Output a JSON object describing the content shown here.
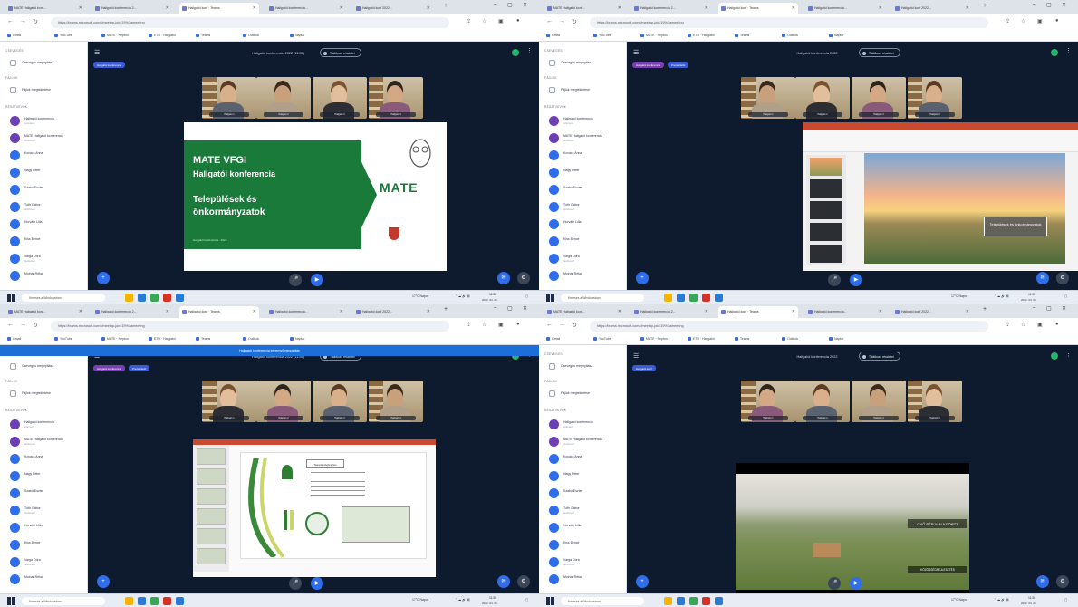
{
  "screens": [
    {
      "tabs": [
        "MATE Hallgatói konf...",
        "Hallgatói konferencia 2...",
        "Hallgatói konf · Teams",
        "Hallgatói konferencia...",
        "Hallgatói konf 2022..."
      ],
      "url": "https://teams.microsoft.com/l/meetup-join/19%3ameeting",
      "bookmarks": [
        "Gmail",
        "YouTube",
        "MATE · Neptun",
        "ETR · Hallgatói",
        "Teams",
        "Outlook",
        "Naptár"
      ],
      "banner": "",
      "meeting_title": "Hallgatói konferencia 2022 (11:55)",
      "action_button": "Találkozó részletei",
      "chips": [
        "Hallgatói konferencia"
      ],
      "thumbs": [
        "Hallgató 1",
        "Hallgató 2",
        "Hallgató 3",
        "Hallgató 4"
      ],
      "slide": {
        "title": "MATE VFGI",
        "subtitle": "Hallgatói konferencia",
        "topic1": "Települések és",
        "topic2": "önkormányzatok",
        "footer": "Hallgatói konferencia · 2022",
        "logo": "MATE"
      }
    },
    {
      "tabs": [
        "MATE Hallgatói konf...",
        "Hallgatói konferencia 2...",
        "Hallgatói konf · Teams",
        "Hallgatói konferencia...",
        "Hallgatói konf 2022..."
      ],
      "url": "https://teams.microsoft.com/l/meetup-join/19%3ameeting",
      "bookmarks": [
        "Gmail",
        "YouTube",
        "MATE · Neptun",
        "ETR · Hallgatói",
        "Teams",
        "Outlook",
        "Naptár"
      ],
      "banner": "",
      "meeting_title": "Hallgatói konferencia 2022",
      "action_button": "Találkozó részletei",
      "chips": [
        "Hallgatói konferencia",
        "Prezentáció"
      ],
      "thumbs": [
        "Hallgató 1",
        "Hallgató 2",
        "Hallgató 3",
        "Hallgató 4"
      ],
      "slide": {
        "caption": "Települések és önkormányzatok"
      }
    },
    {
      "tabs": [
        "MATE Hallgatói konf...",
        "Hallgatói konferencia 2...",
        "Hallgatói konf · Teams",
        "Hallgatói konferencia...",
        "Hallgatói konf 2022..."
      ],
      "url": "https://teams.microsoft.com/l/meetup-join/19%3ameeting",
      "bookmarks": [
        "Gmail",
        "YouTube",
        "MATE · Neptun",
        "ETR · Hallgatói",
        "Teams",
        "Outlook",
        "Naptár"
      ],
      "banner": "Hallgatói konferencia képernyőmegosztás",
      "meeting_title": "Hallgatói konferencia 2022 (11:55)",
      "action_button": "Találkozó részletei",
      "chips": [
        "Hallgatói konferencia",
        "Prezentáció"
      ],
      "thumbs": [
        "Hallgató 1",
        "Hallgató 2",
        "Hallgató 3",
        "Hallgató 4"
      ],
      "slide": {
        "box": "Településfejlesztés"
      }
    },
    {
      "tabs": [
        "MATE Hallgatói konf...",
        "Hallgatói konferencia 2...",
        "Hallgatói konf · Teams",
        "Hallgatói konferencia...",
        "Hallgatói konf 2022..."
      ],
      "url": "https://teams.microsoft.com/l/meetup-join/19%3ameeting",
      "bookmarks": [
        "Gmail",
        "YouTube",
        "MATE · Neptun",
        "ETR · Hallgatói",
        "Teams",
        "Outlook",
        "Naptár"
      ],
      "banner": "",
      "meeting_title": "Hallgatói konferencia 2022",
      "action_button": "Találkozó részletei",
      "chips": [
        "Hallgatói konf"
      ],
      "thumbs": [
        "Hallgató 1",
        "Hallgató 2",
        "Hallgató 3",
        "Hallgató 4"
      ],
      "slide": {
        "overlay1": "GYŐ PÉR VAN AZ ÖRTT",
        "overlay2": "KÖZÖSSÉGFEJLESZTÉS"
      }
    }
  ],
  "sidebar": {
    "section1": "Csevegés",
    "item1": "Csevegés megnyitása",
    "section2": "Fájlok",
    "item2": "Fájlok megtekintése",
    "section3": "Résztvevők",
    "users": [
      {
        "name": "Hallgatói konferencia",
        "sub": "szervező"
      },
      {
        "name": "MATE Hallgatói konferencia",
        "sub": "résztvevő"
      },
      {
        "name": "Kovács Anna",
        "sub": ""
      },
      {
        "name": "Nagy Péter",
        "sub": ""
      },
      {
        "name": "Szabó Eszter",
        "sub": ""
      },
      {
        "name": "Tóth Gábor",
        "sub": "résztvevő"
      },
      {
        "name": "Horváth Lilla",
        "sub": ""
      },
      {
        "name": "Kiss Bence",
        "sub": ""
      },
      {
        "name": "Varga Dóra",
        "sub": "résztvevő"
      },
      {
        "name": "Molnár Réka",
        "sub": ""
      }
    ]
  },
  "taskbar": {
    "search": "Keresés a Windowsban",
    "weather": "17°C Napos",
    "time": "11:55",
    "date": "2022. 04. 26."
  },
  "colors": {
    "teams_bg": "#0e1a2e",
    "mate_green": "#1a7a3a",
    "accent_blue": "#2f6dea"
  }
}
